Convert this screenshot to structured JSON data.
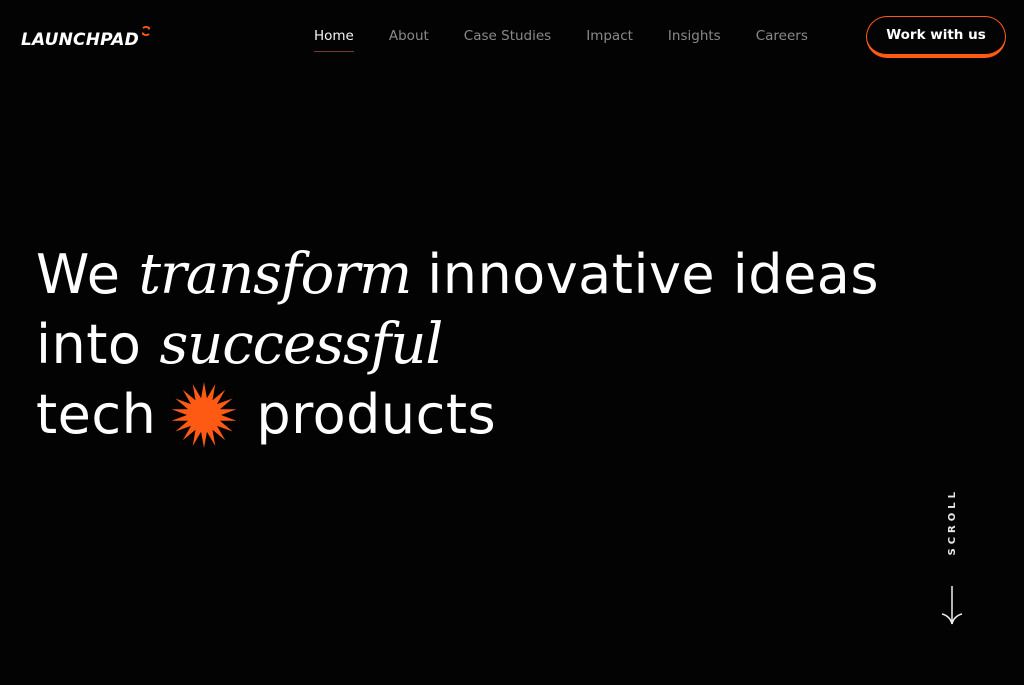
{
  "header": {
    "logo_text": "LAUNCHPAD",
    "logo_mark_icon": "refresh-arrows-icon",
    "nav": [
      {
        "label": "Home",
        "active": true
      },
      {
        "label": "About",
        "active": false
      },
      {
        "label": "Case Studies",
        "active": false
      },
      {
        "label": "Impact",
        "active": false
      },
      {
        "label": "Insights",
        "active": false
      },
      {
        "label": "Careers",
        "active": false
      }
    ],
    "cta_label": "Work with us"
  },
  "hero": {
    "line1": {
      "pre": "We",
      "emphasis": "transform",
      "post": "innovative ideas"
    },
    "line2": {
      "pre": "into",
      "emphasis": "successful"
    },
    "line3": {
      "pre": "tech",
      "icon": "starburst-icon",
      "post": "products"
    }
  },
  "scroll": {
    "label": "SCROLL",
    "icon": "arrow-down-icon"
  },
  "colors": {
    "background": "#030303",
    "accent": "#ff5a14",
    "text": "#ffffff",
    "nav_inactive": "#8a8a8a"
  }
}
